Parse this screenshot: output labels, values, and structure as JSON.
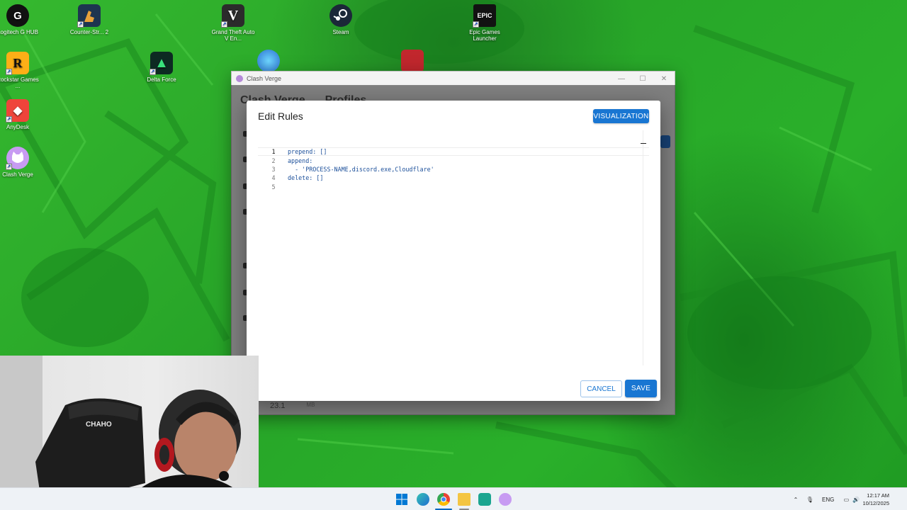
{
  "desktop": {
    "icons": [
      {
        "label": "Logitech G HUB",
        "icon": "logitech-g-icon",
        "color": "#111111",
        "glyph": "G"
      },
      {
        "label": "Counter-Str... 2",
        "icon": "counter-strike-icon",
        "color": "#1d3550",
        "glyph": ""
      },
      {
        "label": "Grand Theft Auto V En...",
        "icon": "gta-v-icon",
        "color": "#2b2b2b",
        "glyph": "V"
      },
      {
        "label": "Steam",
        "icon": "steam-icon",
        "color": "#1b2838",
        "glyph": ""
      },
      {
        "label": "Epic Games Launcher",
        "icon": "epic-games-icon",
        "color": "#121212",
        "glyph": "EPIC"
      },
      {
        "label": "Rockstar Games ...",
        "icon": "rockstar-icon",
        "color": "#fcaf17",
        "glyph": "R"
      },
      {
        "label": "Delta Force",
        "icon": "delta-force-icon",
        "color": "#0d2a22",
        "glyph": "▲"
      },
      {
        "label": "AnyDesk",
        "icon": "anydesk-icon",
        "color": "#ef443b",
        "glyph": "◆"
      },
      {
        "label": "Clash Verge",
        "icon": "clash-verge-icon",
        "color": "#c79bf2",
        "glyph": "🐱"
      }
    ]
  },
  "app_window": {
    "title": "Clash Verge",
    "header_left": "Clash Verge",
    "header_right": "Profiles",
    "stat_value": "23.1",
    "stat_unit": "MB"
  },
  "dialog": {
    "title": "Edit Rules",
    "visualization_label": "VISUALIZATION",
    "cancel_label": "CANCEL",
    "save_label": "SAVE",
    "editor_lines": [
      {
        "num": "1",
        "text": "prepend: []"
      },
      {
        "num": "2",
        "text": "append:"
      },
      {
        "num": "3",
        "text": "  - 'PROCESS-NAME,discord.exe,Cloudflare'"
      },
      {
        "num": "4",
        "text": "delete: []"
      },
      {
        "num": "5",
        "text": ""
      }
    ]
  },
  "webcam": {
    "chair_brand": "CHAHO"
  },
  "taskbar": {
    "language": "ENG",
    "time": "12:17 AM",
    "date": "10/12/2025",
    "accent": "#0067c0"
  }
}
